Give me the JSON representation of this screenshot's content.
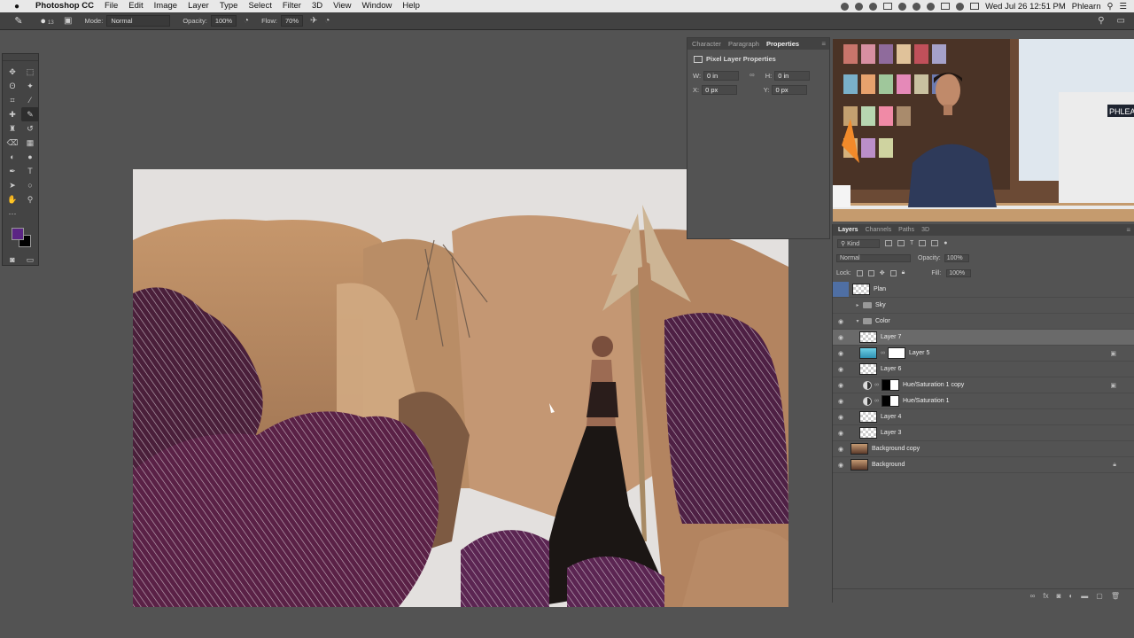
{
  "menubar": {
    "app_name": "Photoshop CC",
    "items": [
      "File",
      "Edit",
      "Image",
      "Layer",
      "Type",
      "Select",
      "Filter",
      "3D",
      "View",
      "Window",
      "Help"
    ],
    "clock": "Wed Jul 26  12:51 PM",
    "user": "Phlearn"
  },
  "options": {
    "brush_size": "13",
    "mode_label": "Mode:",
    "mode_value": "Normal",
    "opacity_label": "Opacity:",
    "opacity_value": "100%",
    "flow_label": "Flow:",
    "flow_value": "70%"
  },
  "colors": {
    "foreground": "#5b2584",
    "background": "#000000",
    "selected_layer": "#6a6a6a"
  },
  "properties": {
    "tabs": [
      "Character",
      "Paragraph",
      "Properties"
    ],
    "active_tab": "Properties",
    "title": "Pixel Layer Properties",
    "w_label": "W:",
    "w_value": "0 in",
    "h_label": "H:",
    "h_value": "0 in",
    "x_label": "X:",
    "x_value": "0 px",
    "y_label": "Y:",
    "y_value": "0 px"
  },
  "layers_panel": {
    "tabs": [
      "Layers",
      "Channels",
      "Paths",
      "3D"
    ],
    "active_tab": "Layers",
    "kind_label": "Kind",
    "blend_mode": "Normal",
    "opacity_label": "Opacity:",
    "opacity_value": "100%",
    "lock_label": "Lock:",
    "fill_label": "Fill:",
    "fill_value": "100%",
    "layers": [
      {
        "name": "Plan",
        "visible": false,
        "type": "pixel"
      },
      {
        "name": "Sky",
        "visible": false,
        "type": "group"
      },
      {
        "name": "Color",
        "visible": true,
        "type": "group-open"
      },
      {
        "name": "Layer 7",
        "visible": true,
        "type": "pixel",
        "selected": true
      },
      {
        "name": "Layer 5",
        "visible": true,
        "type": "pixel-mask"
      },
      {
        "name": "Layer 6",
        "visible": true,
        "type": "pixel"
      },
      {
        "name": "Hue/Saturation 1 copy",
        "visible": true,
        "type": "adjustment"
      },
      {
        "name": "Hue/Saturation 1",
        "visible": true,
        "type": "adjustment"
      },
      {
        "name": "Layer 4",
        "visible": true,
        "type": "pixel"
      },
      {
        "name": "Layer 3",
        "visible": true,
        "type": "pixel"
      },
      {
        "name": "Background copy",
        "visible": true,
        "type": "photo"
      },
      {
        "name": "Background",
        "visible": true,
        "type": "photo-locked"
      }
    ]
  },
  "webcam": {
    "sign_text": "PHLEA"
  }
}
